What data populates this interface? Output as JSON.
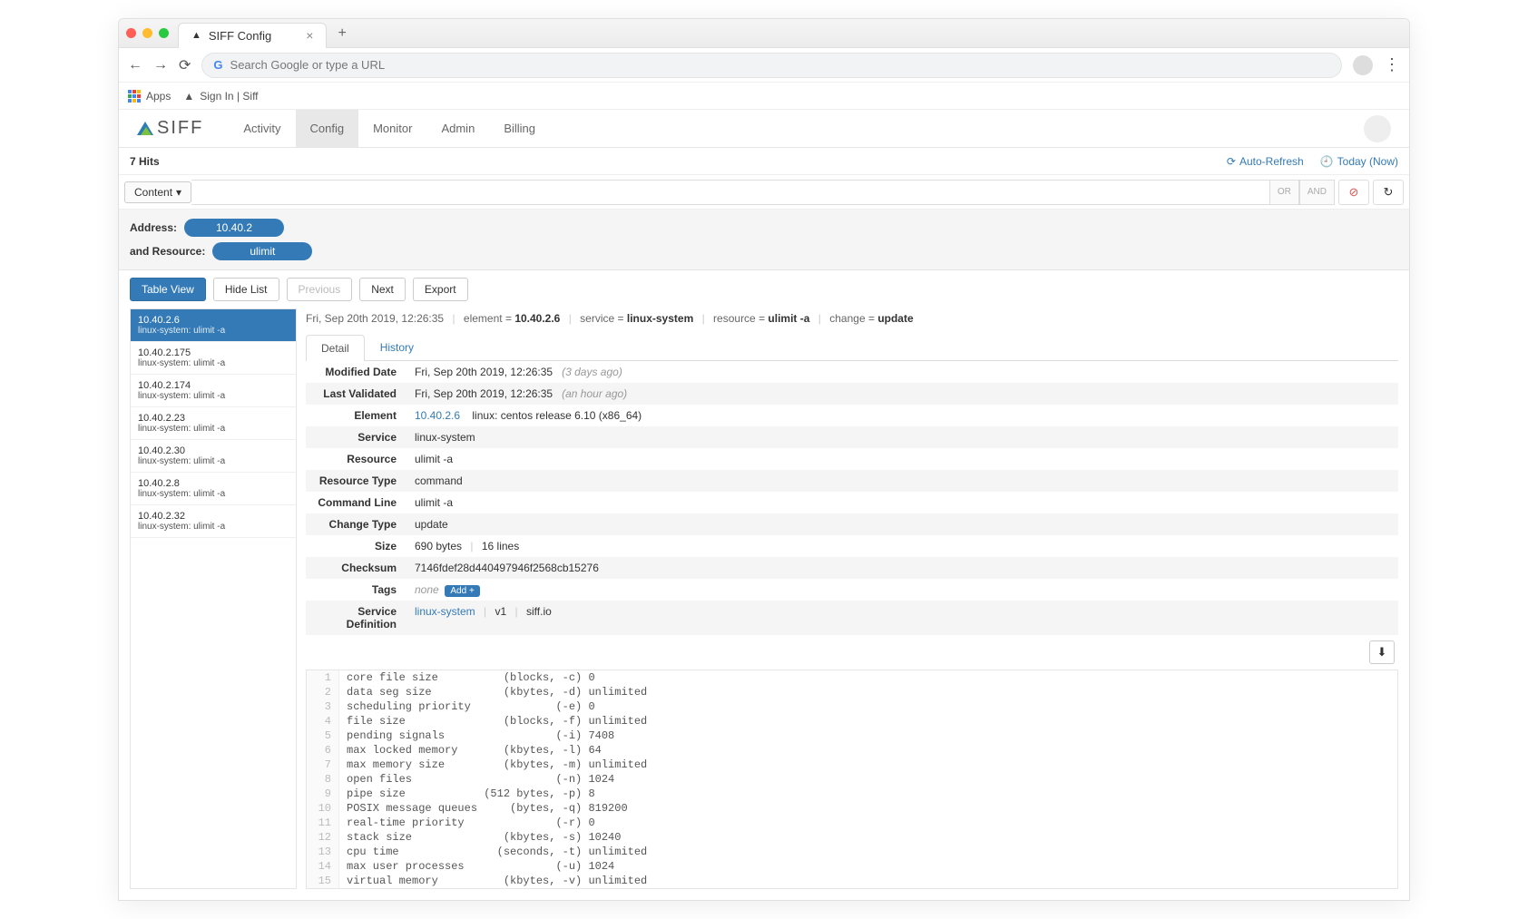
{
  "browser": {
    "tab_title": "SIFF Config",
    "omnibox_placeholder": "Search Google or type a URL",
    "bookmarks": {
      "apps": "Apps",
      "signin": "Sign In | Siff"
    }
  },
  "app": {
    "brand": "SIFF",
    "nav": [
      "Activity",
      "Config",
      "Monitor",
      "Admin",
      "Billing"
    ],
    "active_nav": "Config"
  },
  "hits": "7 Hits",
  "top_links": {
    "refresh": "Auto-Refresh",
    "today": "Today (Now)"
  },
  "searchbar": {
    "content": "Content",
    "or": "OR",
    "and": "AND"
  },
  "filters": {
    "address_label": "Address:",
    "address_value": "10.40.2",
    "resource_label": "and Resource:",
    "resource_value": "ulimit"
  },
  "actions": {
    "table": "Table View",
    "hide": "Hide List",
    "prev": "Previous",
    "next": "Next",
    "export": "Export"
  },
  "sidebar": [
    {
      "ip": "10.40.2.6",
      "sub": "linux-system: ulimit -a",
      "active": true
    },
    {
      "ip": "10.40.2.175",
      "sub": "linux-system: ulimit -a"
    },
    {
      "ip": "10.40.2.174",
      "sub": "linux-system: ulimit -a"
    },
    {
      "ip": "10.40.2.23",
      "sub": "linux-system: ulimit -a"
    },
    {
      "ip": "10.40.2.30",
      "sub": "linux-system: ulimit -a"
    },
    {
      "ip": "10.40.2.8",
      "sub": "linux-system: ulimit -a"
    },
    {
      "ip": "10.40.2.32",
      "sub": "linux-system: ulimit -a"
    }
  ],
  "crumb": {
    "date": "Fri, Sep 20th 2019, 12:26:35",
    "element_label": "element =",
    "element_value": "10.40.2.6",
    "service_label": "service =",
    "service_value": "linux-system",
    "resource_label": "resource =",
    "resource_value": "ulimit -a",
    "change_label": "change =",
    "change_value": "update"
  },
  "tabs2": {
    "detail": "Detail",
    "history": "History"
  },
  "detail": {
    "modified_label": "Modified Date",
    "modified_val": "Fri, Sep 20th 2019, 12:26:35",
    "modified_rel": "(3 days ago)",
    "validated_label": "Last Validated",
    "validated_val": "Fri, Sep 20th 2019, 12:26:35",
    "validated_rel": "(an hour ago)",
    "element_label": "Element",
    "element_link": "10.40.2.6",
    "element_extra": "linux: centos release 6.10 (x86_64)",
    "service_label": "Service",
    "service_val": "linux-system",
    "resource_label": "Resource",
    "resource_val": "ulimit -a",
    "restype_label": "Resource Type",
    "restype_val": "command",
    "cmdline_label": "Command Line",
    "cmdline_val": "ulimit -a",
    "changetype_label": "Change Type",
    "changetype_val": "update",
    "size_label": "Size",
    "size_val": "690 bytes",
    "size_lines": "16 lines",
    "checksum_label": "Checksum",
    "checksum_val": "7146fdef28d440497946f2568cb15276",
    "tags_label": "Tags",
    "tags_val": "none",
    "tags_add": "Add +",
    "svcdef_label": "Service Definition",
    "svcdef_link": "linux-system",
    "svcdef_v": "v1",
    "svcdef_site": "siff.io"
  },
  "code": [
    "core file size          (blocks, -c) 0",
    "data seg size           (kbytes, -d) unlimited",
    "scheduling priority             (-e) 0",
    "file size               (blocks, -f) unlimited",
    "pending signals                 (-i) 7408",
    "max locked memory       (kbytes, -l) 64",
    "max memory size         (kbytes, -m) unlimited",
    "open files                      (-n) 1024",
    "pipe size            (512 bytes, -p) 8",
    "POSIX message queues     (bytes, -q) 819200",
    "real-time priority              (-r) 0",
    "stack size              (kbytes, -s) 10240",
    "cpu time               (seconds, -t) unlimited",
    "max user processes              (-u) 1024",
    "virtual memory          (kbytes, -v) unlimited"
  ]
}
